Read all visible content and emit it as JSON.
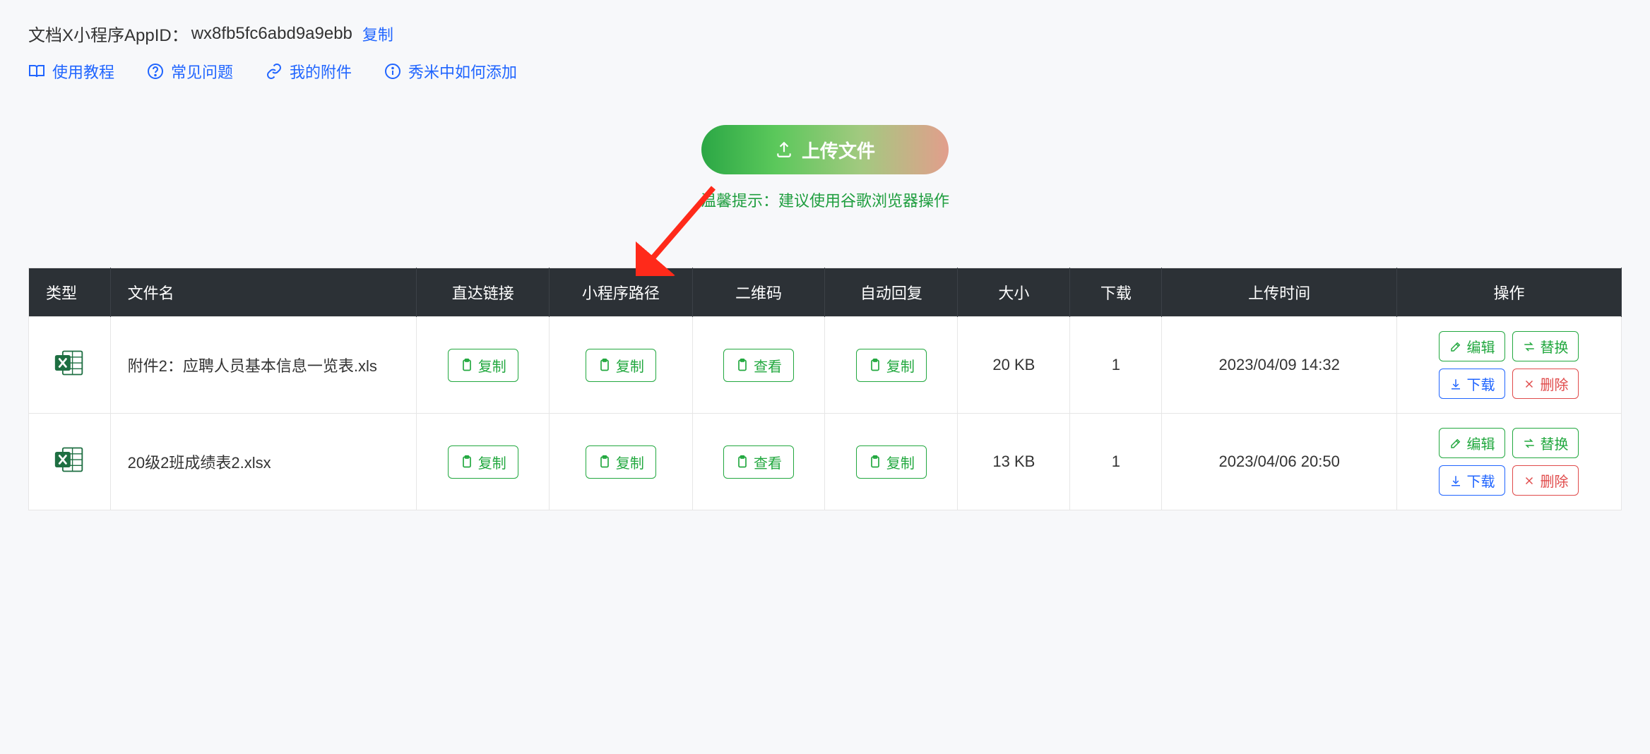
{
  "header": {
    "appid_label_prefix": "文档X小程序AppID：",
    "appid_value": "wx8fb5fc6abd9a9ebb",
    "copy": "复制"
  },
  "top_links": {
    "tutorial": "使用教程",
    "faq": "常见问题",
    "attachments": "我的附件",
    "xiumi": "秀米中如何添加"
  },
  "upload": {
    "button": "上传文件",
    "hint": "温馨提示：建议使用谷歌浏览器操作"
  },
  "table": {
    "headers": {
      "type": "类型",
      "name": "文件名",
      "link": "直达链接",
      "path": "小程序路径",
      "qr": "二维码",
      "auto": "自动回复",
      "size": "大小",
      "dl": "下载",
      "time": "上传时间",
      "acts": "操作"
    },
    "buttons": {
      "copy": "复制",
      "view": "查看",
      "edit": "编辑",
      "replace": "替换",
      "download": "下载",
      "delete": "删除"
    },
    "rows": [
      {
        "name": "附件2：应聘人员基本信息一览表.xls",
        "size": "20 KB",
        "download_count": "1",
        "time": "2023/04/09 14:32"
      },
      {
        "name": "20级2班成绩表2.xlsx",
        "size": "13 KB",
        "download_count": "1",
        "time": "2023/04/06 20:50"
      }
    ]
  }
}
